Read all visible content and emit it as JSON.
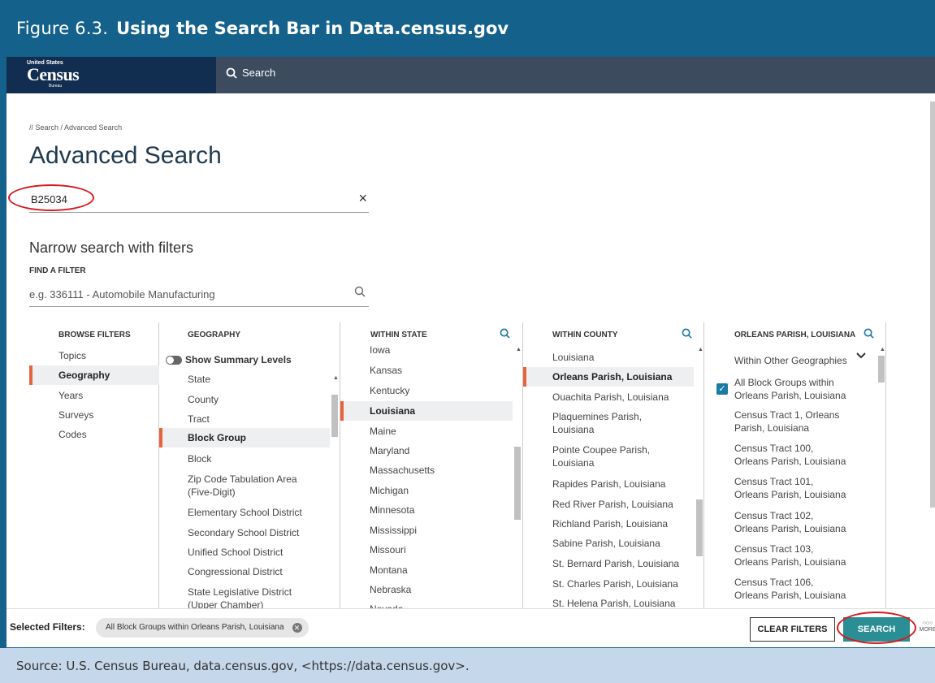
{
  "figure": {
    "number": "Figure 6.3.",
    "title": "Using the Search Bar in Data.census.gov",
    "source": "Source: U.S. Census Bureau, data.census.gov, <https://data.census.gov>."
  },
  "colors": {
    "figure_header": "#14618c",
    "app_topbar": "#3c4b5e",
    "logo_bg": "#112e51",
    "accent": "#e6643c",
    "search_button": "#2b8e94",
    "highlight_oval": "#d7191c",
    "footer": "#c5d7ea"
  },
  "topbar": {
    "logo_small": "United States",
    "logo_main": "Census",
    "logo_sub": "Bureau",
    "search_label": "Search"
  },
  "page": {
    "breadcrumb": "// Search / Advanced Search",
    "title": "Advanced Search",
    "query_value": "B25034",
    "clear_icon": "×",
    "narrow_title": "Narrow search with filters",
    "find_label": "FIND A FILTER",
    "filter_placeholder": "e.g. 336111 - Automobile Manufacturing"
  },
  "columns": {
    "browse": {
      "header": "BROWSE FILTERS",
      "items": [
        "Topics",
        "Geography",
        "Years",
        "Surveys",
        "Codes"
      ]
    },
    "geography": {
      "header": "GEOGRAPHY",
      "toggle_label": "Show Summary Levels",
      "items": [
        "State",
        "County",
        "Tract",
        "Block Group",
        "Block",
        "Zip Code Tabulation Area (Five-Digit)",
        "Elementary School District",
        "Secondary School District",
        "Unified School District",
        "Congressional District",
        "State Legislative District (Upper Chamber)"
      ]
    },
    "state": {
      "header": "WITHIN STATE",
      "items": [
        "Iowa",
        "Kansas",
        "Kentucky",
        "Louisiana",
        "Maine",
        "Maryland",
        "Massachusetts",
        "Michigan",
        "Minnesota",
        "Mississippi",
        "Missouri",
        "Montana",
        "Nebraska",
        "Nevada"
      ]
    },
    "county": {
      "header": "WITHIN COUNTY",
      "items": [
        "Louisiana",
        "Orleans Parish, Louisiana",
        "Ouachita Parish, Louisiana",
        "Plaquemines Parish, Louisiana",
        "Pointe Coupee Parish, Louisiana",
        "Rapides Parish, Louisiana",
        "Red River Parish, Louisiana",
        "Richland Parish, Louisiana",
        "Sabine Parish, Louisiana",
        "St. Bernard Parish, Louisiana",
        "St. Charles Parish, Louisiana",
        "St. Helena Parish, Louisiana"
      ]
    },
    "parish": {
      "header": "ORLEANS PARISH, LOUISIANA",
      "dropdown_label": "Within Other Geographies",
      "items": [
        "All Block Groups within Orleans Parish, Louisiana",
        "Census Tract 1, Orleans Parish, Louisiana",
        "Census Tract 100, Orleans Parish, Louisiana",
        "Census Tract 101, Orleans Parish, Louisiana",
        "Census Tract 102, Orleans Parish, Louisiana",
        "Census Tract 103, Orleans Parish, Louisiana",
        "Census Tract 106, Orleans Parish, Louisiana"
      ]
    }
  },
  "selected": {
    "label": "Selected Filters:",
    "chip": "All Block Groups within Orleans Parish, Louisiana",
    "clear_button": "CLEAR FILTERS",
    "search_button": "SEARCH",
    "more_label": "MORE"
  }
}
